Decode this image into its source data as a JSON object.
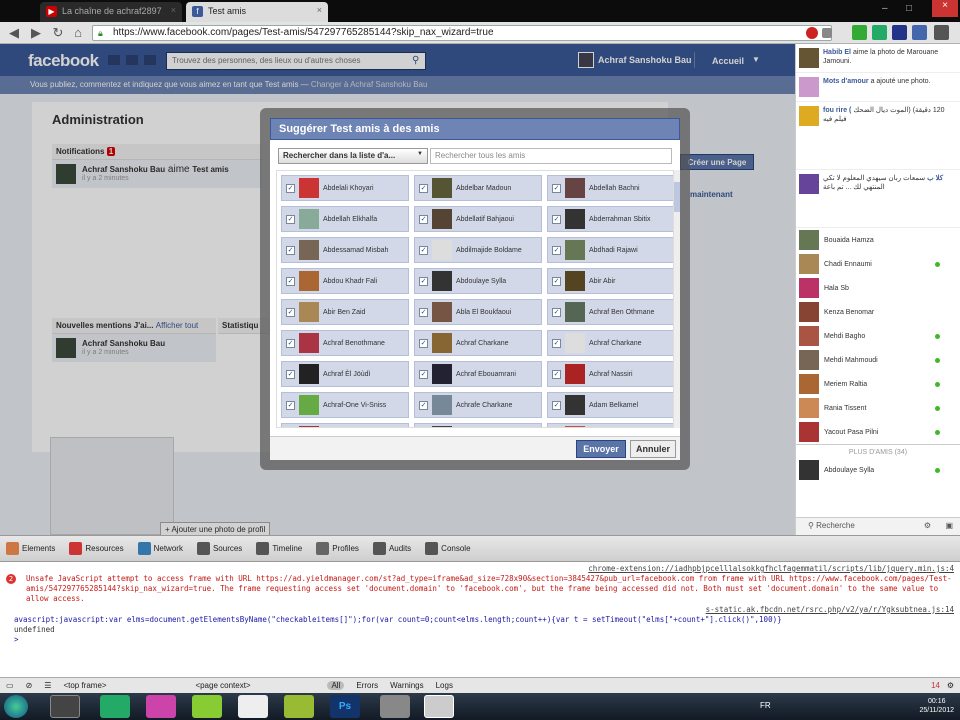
{
  "browser": {
    "tabs": [
      {
        "title": "La chaîne de achraf2897"
      },
      {
        "title": "Test amis"
      }
    ],
    "url": "https://www.facebook.com/pages/Test-amis/547297765285144?skip_nax_wizard=true"
  },
  "fb": {
    "logo": "facebook",
    "search_placeholder": "Trouvez des personnes, des lieux ou d'autres choses",
    "user_name": "Achraf Sanshoku Bau",
    "home": "Accueil",
    "voice_text": "Vous publiez, commentez et indiquez que vous aimez en tant que Test amis —",
    "voice_link": "Changer à Achraf Sanshoku Bau"
  },
  "admin": {
    "title": "Administration",
    "notifications_label": "Notifications",
    "notifications_count": "1",
    "notif_name": "Achraf Sanshoku Bau",
    "notif_text": "aime",
    "notif_page": "Test amis",
    "notif_time": "il y a 2 minutes",
    "mentions_label": "Nouvelles mentions J'ai...",
    "mentions_link": "Afficher tout",
    "stats_label": "Statistiqu",
    "mention_name": "Achraf Sanshoku Bau",
    "mention_time": "il y a 2 minutes",
    "create_page": "Créer une Page",
    "maintenant": "maintenant",
    "add_photo": "+ Ajouter une photo de profil"
  },
  "dialog": {
    "title": "Suggérer Test amis à des amis",
    "filter": "Rechercher dans la liste d'a...",
    "search_placeholder": "Rechercher tous les amis",
    "send": "Envoyer",
    "cancel": "Annuler",
    "friends": [
      {
        "name": "Abdelali Khoyari",
        "color": "#c33"
      },
      {
        "name": "Abdelbar Madoun",
        "color": "#553"
      },
      {
        "name": "Abdellah Bachni",
        "color": "#644"
      },
      {
        "name": "Abdellah Elkhalfa",
        "color": "#8a9"
      },
      {
        "name": "Abdellatif Bahjaoui",
        "color": "#543"
      },
      {
        "name": "Abderrahman Sbitix",
        "color": "#333"
      },
      {
        "name": "Abdessamad Misbah",
        "color": "#765"
      },
      {
        "name": "Abdilmajide Boldame",
        "color": "#ddd"
      },
      {
        "name": "Abdhadi Rajawi",
        "color": "#675"
      },
      {
        "name": "Abdou Khadr Fali",
        "color": "#a63"
      },
      {
        "name": "Abdoulaye Sylla",
        "color": "#333"
      },
      {
        "name": "Abir Abir",
        "color": "#542"
      },
      {
        "name": "Abir Ben Zaid",
        "color": "#a85"
      },
      {
        "name": "Abla El Boukfaoui",
        "color": "#754"
      },
      {
        "name": "Achraf Ben Othmane",
        "color": "#565"
      },
      {
        "name": "Achraf Benothmane",
        "color": "#a34"
      },
      {
        "name": "Achraf Charkane",
        "color": "#863"
      },
      {
        "name": "Achraf Charkane",
        "color": "#ddd"
      },
      {
        "name": "Achraf Èl Jöùdì",
        "color": "#222"
      },
      {
        "name": "Achraf Ebouamrani",
        "color": "#223"
      },
      {
        "name": "Achraf Nassiri",
        "color": "#a22"
      },
      {
        "name": "Achraf-One Vi-Sniss",
        "color": "#6a4"
      },
      {
        "name": "Achrafe Charkane",
        "color": "#789"
      },
      {
        "name": "Adam Belkamel",
        "color": "#333"
      },
      {
        "name": "Adam El Guennac",
        "color": "#a33"
      },
      {
        "name": "Adam El Haouri",
        "color": "#444"
      },
      {
        "name": "Adam Gadji",
        "color": "#b54"
      }
    ]
  },
  "sidebar": {
    "ticker": [
      {
        "name": "Habib El",
        "text": "aime la photo de Marouane Jamouni.",
        "color": "#653"
      },
      {
        "name": "Mots d'amour",
        "text": "a ajouté une photo.",
        "color": "#c9c"
      },
      {
        "name": "fou rire (",
        "text": "الموت ديال الضحك) (120 دقيقة فيلم فيه",
        "color": "#da2"
      },
      {
        "name": "كلا ب",
        "text": "سمعات ربان سيهدي المعلوم لا تكي المنتهي لك ... تم باعة",
        "color": "#649"
      }
    ],
    "chat_header": "PLUS D'AMIS (34)",
    "chat": [
      {
        "name": "Bouaida Hamza",
        "online": false,
        "color": "#675"
      },
      {
        "name": "Chadi Ennaumi",
        "online": true,
        "color": "#a85"
      },
      {
        "name": "Hala Sb",
        "online": false,
        "color": "#b36"
      },
      {
        "name": "Kenza Benomar",
        "online": false,
        "color": "#843"
      },
      {
        "name": "Mehdi Bagho",
        "online": true,
        "color": "#a54"
      },
      {
        "name": "Mehdi Mahmoudi",
        "online": true,
        "color": "#765"
      },
      {
        "name": "Meriem Raltia",
        "online": true,
        "color": "#a63"
      },
      {
        "name": "Rania Tissent",
        "online": true,
        "color": "#c85"
      },
      {
        "name": "Yacout Pasa Pilni",
        "online": true,
        "color": "#a33"
      },
      {
        "name": "Abdoulaye Sylla",
        "online": true,
        "color": "#333"
      }
    ],
    "chat_search": "Recherche"
  },
  "devtools": {
    "tabs": [
      "Elements",
      "Resources",
      "Network",
      "Sources",
      "Timeline",
      "Profiles",
      "Audits",
      "Console"
    ],
    "src1": "chrome-extension://iadhpbjpcelllalsokkgfhclfagemmatil/scripts/lib/jquery.min.js:4",
    "err": "Unsafe JavaScript attempt to access frame with URL https://ad.yieldmanager.com/st?ad_type=iframe&ad_size=728x90&section=3845427&pub_url=facebook.com from frame with URL https://www.facebook.com/pages/Test-amis/547297765285144?skip_nax_wizard=true. The frame requesting access set 'document.domain' to 'facebook.com', but the frame being accessed did not. Both must set 'document.domain' to the same value to allow access.",
    "src2": "s-static.ak.fbcdn.net/rsrc.php/v2/ya/r/Ygksubtnea.js:14",
    "cmd": "avascript:javascript:var elms=document.getElementsByName(\"checkableitems[]\");for(var count=0;count<elms.length;count++){var t = setTimeout(\"elms[\"+count+\"].click()\",100)}",
    "out": "undefined",
    "frame": "<top frame>",
    "context": "<page context>",
    "filters": [
      "All",
      "Errors",
      "Warnings",
      "Logs"
    ],
    "err_count": "14"
  },
  "taskbar": {
    "lang": "FR",
    "time": "00:16",
    "date": "25/11/2012"
  }
}
